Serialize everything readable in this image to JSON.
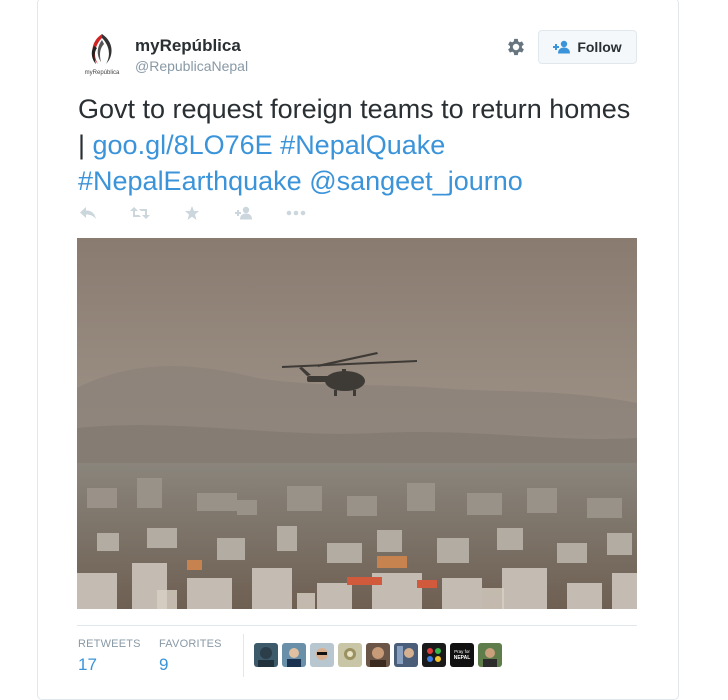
{
  "user": {
    "display_name": "myRepública",
    "handle": "@RepublicaNepal",
    "avatar_caption": "myRepública"
  },
  "follow_button": {
    "label": "Follow"
  },
  "tweet": {
    "text_plain": "Govt to request foreign teams to return homes | ",
    "link": "goo.gl/8LO76E",
    "hashtag_1": "#NepalQuake",
    "hashtag_2": "#NepalEarthquake",
    "mention": "@sangeet_journo"
  },
  "actions": [
    "reply-icon",
    "retweet-icon",
    "favorite-icon",
    "follow-icon",
    "more-icon"
  ],
  "stats": {
    "retweets_label": "RETWEETS",
    "retweets_value": "17",
    "favorites_label": "FAVORITES",
    "favorites_value": "9"
  },
  "favoriters": [
    {
      "name": "favoriter-avatar-1",
      "color": "#3d5a6b"
    },
    {
      "name": "favoriter-avatar-2",
      "color": "#6a8fa8"
    },
    {
      "name": "favoriter-avatar-3",
      "color": "#b8c6d0"
    },
    {
      "name": "favoriter-avatar-4",
      "color": "#c9c6a8"
    },
    {
      "name": "favoriter-avatar-5",
      "color": "#6b5546"
    },
    {
      "name": "favoriter-avatar-6",
      "color": "#4a5e7a"
    },
    {
      "name": "favoriter-avatar-7",
      "color": "#1a1a1a"
    },
    {
      "name": "favoriter-avatar-8",
      "color": "#111111",
      "text": "Pray for NEPAL"
    },
    {
      "name": "favoriter-avatar-9",
      "color": "#5f7d4a"
    }
  ],
  "colors": {
    "link": "#3b94d9",
    "text": "#292f33",
    "muted": "#8899a6",
    "border": "#e1e8ed"
  }
}
